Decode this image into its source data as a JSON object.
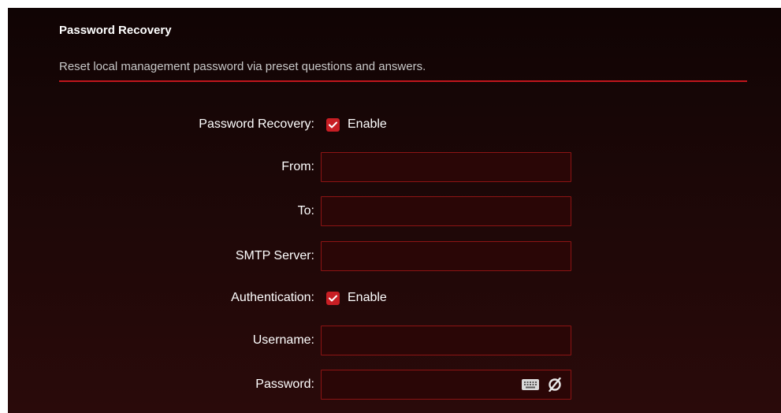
{
  "section": {
    "title": "Password Recovery",
    "description": "Reset local management password via preset questions and answers."
  },
  "form": {
    "password_recovery": {
      "label": "Password Recovery:",
      "checked": true,
      "option_label": "Enable"
    },
    "from": {
      "label": "From:",
      "value": ""
    },
    "to": {
      "label": "To:",
      "value": ""
    },
    "smtp_server": {
      "label": "SMTP Server:",
      "value": ""
    },
    "authentication": {
      "label": "Authentication:",
      "checked": true,
      "option_label": "Enable"
    },
    "username": {
      "label": "Username:",
      "value": ""
    },
    "password": {
      "label": "Password:",
      "value": "",
      "icons": [
        "keyboard-icon",
        "hide-password-icon"
      ]
    }
  },
  "colors": {
    "accent": "#c81e24",
    "background": "#1b0707",
    "field_border": "#8d1414",
    "field_background": "#2a0606"
  }
}
